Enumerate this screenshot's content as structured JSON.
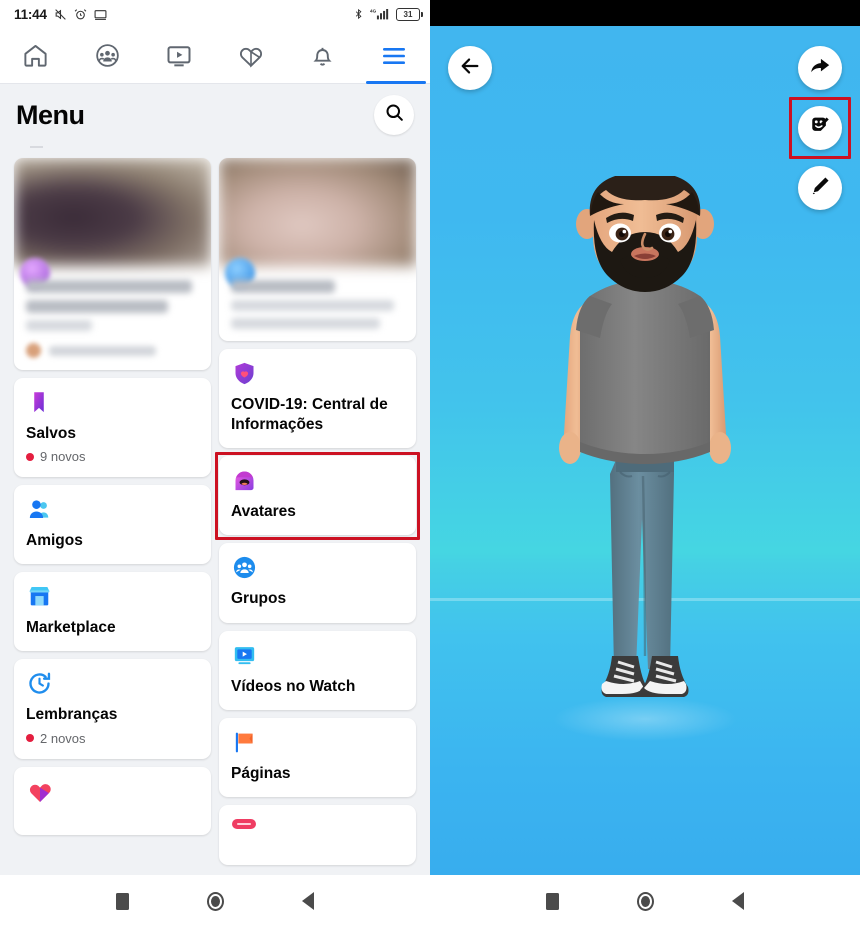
{
  "left": {
    "statusbar": {
      "time": "11:44",
      "icons": [
        "mute-icon",
        "alarm-icon",
        "cast-icon",
        "bluetooth-icon",
        "signal-icon"
      ],
      "network": "4G",
      "battery_level": "31"
    },
    "topnav": [
      {
        "name": "tab-home",
        "icon": "home-icon",
        "active": false
      },
      {
        "name": "tab-groups",
        "icon": "groups-icon",
        "active": false
      },
      {
        "name": "tab-watch",
        "icon": "watch-icon",
        "active": false
      },
      {
        "name": "tab-marketplace",
        "icon": "heart-shop-icon",
        "active": false
      },
      {
        "name": "tab-notifications",
        "icon": "bell-icon",
        "active": false
      },
      {
        "name": "tab-menu",
        "icon": "hamburger-icon",
        "active": true
      }
    ],
    "header": {
      "title": "Menu",
      "search_icon": "search-icon"
    },
    "menu_left_column": [
      {
        "label": "Salvos",
        "sub": "9 novos",
        "icon": "bookmark-icon",
        "has_badge": true
      },
      {
        "label": "Amigos",
        "sub": "",
        "icon": "friends-icon",
        "has_badge": false
      },
      {
        "label": "Marketplace",
        "sub": "",
        "icon": "store-icon",
        "has_badge": false
      },
      {
        "label": "Lembranças",
        "sub": "2 novos",
        "icon": "clock-rewind-icon",
        "has_badge": true
      },
      {
        "label": "",
        "sub": "",
        "icon": "heart-dating-icon",
        "has_badge": false
      }
    ],
    "menu_right_column": [
      {
        "label": "COVID-19: Central de Informações",
        "sub": "",
        "icon": "covid-shield-icon",
        "highlighted": false
      },
      {
        "label": "Avatares",
        "sub": "",
        "icon": "avatar-head-icon",
        "highlighted": true
      },
      {
        "label": "Grupos",
        "sub": "",
        "icon": "groups-circle-icon",
        "highlighted": false
      },
      {
        "label": "Vídeos no Watch",
        "sub": "",
        "icon": "watch-video-icon",
        "highlighted": false
      },
      {
        "label": "Páginas",
        "sub": "",
        "icon": "flag-icon",
        "highlighted": false
      }
    ],
    "navbar": [
      {
        "name": "nav-recents",
        "icon": "square-icon"
      },
      {
        "name": "nav-home",
        "icon": "circle-icon"
      },
      {
        "name": "nav-back",
        "icon": "triangle-back-icon"
      }
    ]
  },
  "right": {
    "buttons": [
      {
        "name": "back-button",
        "icon": "arrow-left-icon",
        "highlighted": false
      },
      {
        "name": "share-button",
        "icon": "share-arrow-icon",
        "highlighted": false
      },
      {
        "name": "stickers-button",
        "icon": "sticker-face-icon",
        "highlighted": true
      },
      {
        "name": "edit-button",
        "icon": "pencil-icon",
        "highlighted": false
      }
    ],
    "avatar": {
      "description": "avatar-figure",
      "skin": "#e8b68d",
      "hair": "#2b2118",
      "beard": "#1e1813",
      "shirt": "#7b7b7b",
      "pants": "#5f7d8f",
      "shoes": "#3d3d3d"
    },
    "navbar": [
      {
        "name": "nav-recents",
        "icon": "square-icon"
      },
      {
        "name": "nav-home",
        "icon": "circle-icon"
      },
      {
        "name": "nav-back",
        "icon": "triangle-back-icon"
      }
    ]
  },
  "colors": {
    "highlight": "#cc1122",
    "fb_blue": "#1877f2",
    "badge_red": "#e41e3f",
    "bg_gray": "#f0f2f5",
    "sky_top": "#41b6ef",
    "sky_mid": "#45d6e2"
  }
}
